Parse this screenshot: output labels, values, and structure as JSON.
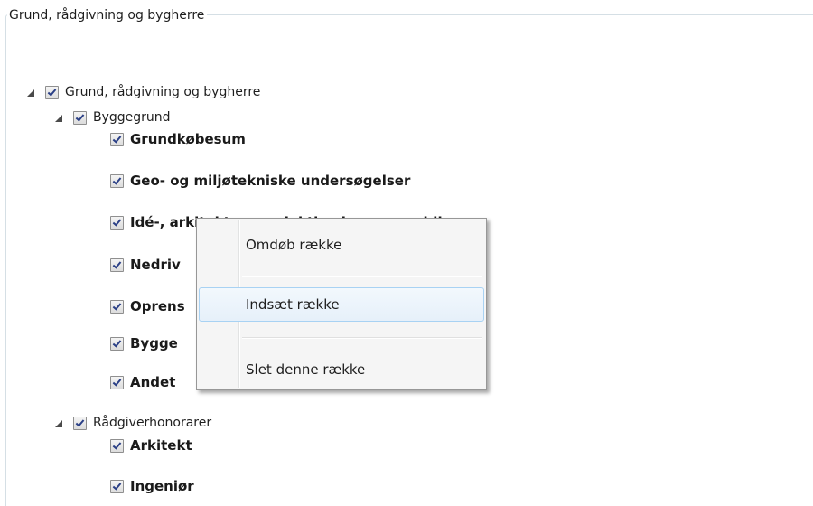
{
  "group": {
    "title": "Grund, rådgivning og bygherre"
  },
  "tree": {
    "root": {
      "label": "Grund, rådgivning og bygherre",
      "checked": true,
      "expanded": true
    },
    "byggegrund": {
      "label": "Byggegrund",
      "checked": true,
      "expanded": true,
      "items": [
        "Grundkøbesum",
        "Geo- og miljøtekniske undersøgelser",
        "Idé-, arkitekt og projektkonkurrence el.lign",
        "Nedriv",
        "Oprens",
        "Bygge",
        "Andet"
      ]
    },
    "raadgiver": {
      "label": "Rådgiverhonorarer",
      "checked": true,
      "expanded": true,
      "items": [
        "Arkitekt",
        "Ingeniør"
      ]
    }
  },
  "context_menu": {
    "items": [
      {
        "label": "Omdøb række",
        "highlighted": false
      },
      {
        "label": "Indsæt række",
        "highlighted": true
      },
      {
        "label": "Slet denne række",
        "highlighted": false
      }
    ]
  },
  "colors": {
    "checkmark": "#2a3f86",
    "menu_highlight_border": "#a8d2f3",
    "groupbox_border": "#d5dfe5"
  }
}
